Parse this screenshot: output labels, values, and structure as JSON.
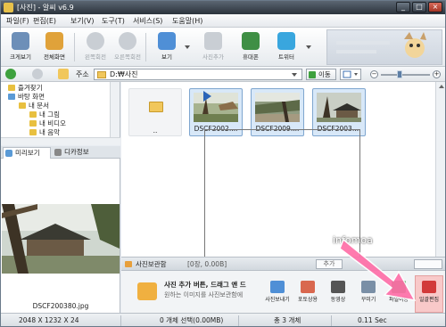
{
  "window": {
    "title": "[사진] - 알씨 v6.9"
  },
  "menu": [
    "파일(F)",
    "편집(E)",
    "보기(V)",
    "도구(T)",
    "서비스(S)",
    "도움말(H)"
  ],
  "toolbar": {
    "tools": [
      {
        "label": "크게보기",
        "icon": "large-view-icon",
        "color": "#6d8fb8"
      },
      {
        "label": "전체화면",
        "icon": "fullscreen-icon",
        "color": "#e0a23a"
      },
      {
        "label": "왼쪽회전",
        "icon": "rotate-left-icon",
        "color": "#c9ced4"
      },
      {
        "label": "오른쪽회전",
        "icon": "rotate-right-icon",
        "color": "#c9ced4"
      },
      {
        "label": "보기",
        "icon": "grid-view-icon",
        "color": "#4f8fd6"
      },
      {
        "label": "사진추가",
        "icon": "add-photo-icon",
        "color": "#c9ced4"
      },
      {
        "label": "휴대폰",
        "icon": "phone-icon",
        "color": "#3f8f45"
      },
      {
        "label": "트위터",
        "icon": "twitter-icon",
        "color": "#39a6de"
      }
    ]
  },
  "address": {
    "label": "주소",
    "path": "D:₩사진",
    "go_label": "이동"
  },
  "tree": {
    "items": [
      {
        "label": "즐겨찾기",
        "color": "#e8c040"
      },
      {
        "label": "바탕 화면",
        "color": "#5a9ad6"
      },
      {
        "label": "내 문서",
        "color": "#e8c040"
      },
      {
        "label": "내 그림",
        "color": "#e8c040"
      },
      {
        "label": "내 비디오",
        "color": "#e8c040"
      },
      {
        "label": "내 음악",
        "color": "#e8c040"
      }
    ]
  },
  "preview": {
    "tabs": [
      "미리보기",
      "디카정보"
    ],
    "filename": "DSCF200380.jpg"
  },
  "files": [
    {
      "name": "..",
      "type": "folder"
    },
    {
      "name": "DSCF2002....",
      "type": "photo"
    },
    {
      "name": "DSCF2009....",
      "type": "photo"
    },
    {
      "name": "DSCF2003....",
      "type": "photo"
    }
  ],
  "photo_box": {
    "title": "사진보관함",
    "count": "[0장, 0.00B]",
    "add_label": "추가",
    "message1": "사진 추가 버튼, 드래그 앤 드",
    "message2": "원하는 이미지를 사진보관함에",
    "tools": [
      {
        "label": "사진보내기",
        "color": "#4f8fd6"
      },
      {
        "label": "포토상용",
        "color": "#d9684f"
      },
      {
        "label": "동영상",
        "color": "#555555"
      },
      {
        "label": "꾸미기",
        "color": "#7a8fa6"
      },
      {
        "label": "파일이동",
        "color": "#3f8f45"
      },
      {
        "label": "일괄편집",
        "color": "#d23a3a"
      }
    ]
  },
  "watermark": "infomoa",
  "status": {
    "dimensions": "2048 X 1232 X 24",
    "selection": "0 개체 선택(0.00MB)",
    "total": "총 3 개체",
    "time": "0.11 Sec"
  },
  "colors": {
    "accent": "#3e6fb0",
    "highlight_arrow": "#ff6fa8"
  }
}
